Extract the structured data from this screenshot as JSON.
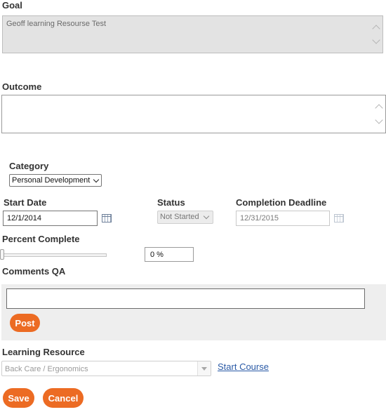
{
  "goal": {
    "label": "Goal",
    "value": "Geoff learning Resourse Test"
  },
  "outcome": {
    "label": "Outcome",
    "value": ""
  },
  "category": {
    "label": "Category",
    "selected": "Personal Development"
  },
  "start_date": {
    "label": "Start Date",
    "value": "12/1/2014"
  },
  "status": {
    "label": "Status",
    "selected": "Not Started"
  },
  "completion_deadline": {
    "label": "Completion Deadline",
    "value": "12/31/2015"
  },
  "percent_complete": {
    "label": "Percent Complete",
    "value_text": "0 %",
    "value": 0
  },
  "comments": {
    "label": "Comments QA",
    "input_value": "",
    "post_label": "Post"
  },
  "learning_resource": {
    "label": "Learning Resource",
    "selected": "Back Care / Ergonomics",
    "link_label": "Start Course"
  },
  "actions": {
    "save_label": "Save",
    "cancel_label": "Cancel"
  },
  "colors": {
    "accent": "#ec6b23",
    "link": "#2a5aa6",
    "disabled_bg": "#e3e3e3",
    "panel_bg": "#eeeeee"
  },
  "icons": {
    "date_picker": "calendar-icon",
    "scroll_up": "chevron-up-icon",
    "scroll_down": "chevron-down-icon",
    "dropdown": "chevron-down-icon"
  }
}
